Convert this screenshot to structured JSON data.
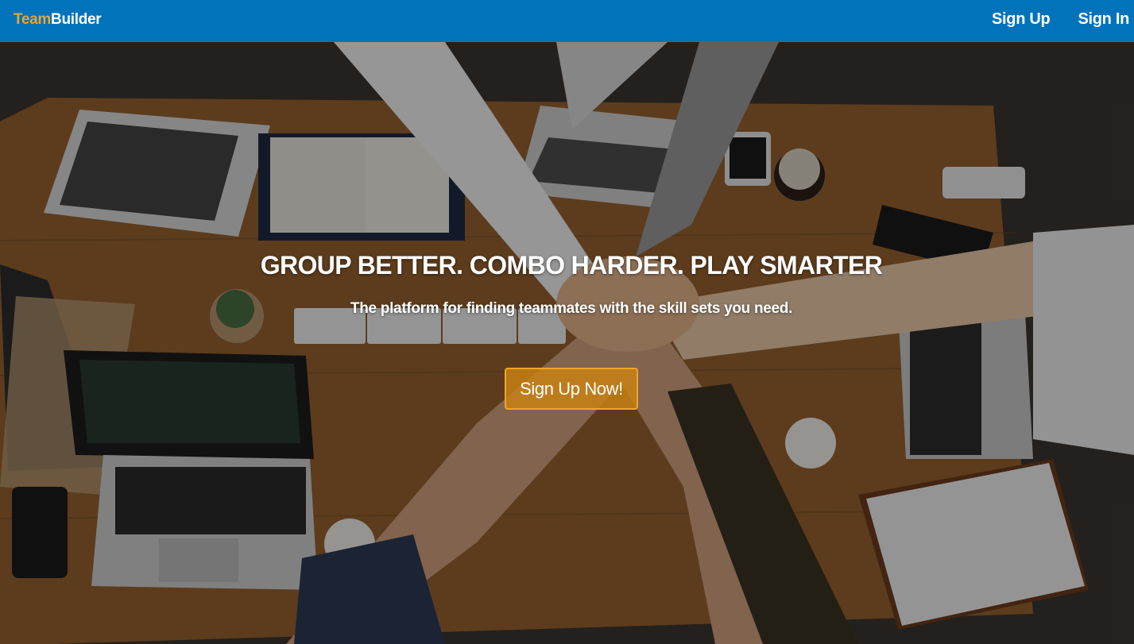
{
  "navbar": {
    "brand_part1": "Team",
    "brand_part2": "Builder",
    "links": [
      "Sign Up",
      "Sign In"
    ],
    "background_color": "#0073bb",
    "brand_accent_color": "#e7a53a"
  },
  "hero": {
    "title": "GROUP BETTER. COMBO HARDER. PLAY SMARTER",
    "subtitle": "The platform for finding teammates with the skill sets you need.",
    "cta_label": "Sign Up Now!",
    "cta_color": "#f0a524",
    "background_image": "team hands stacked over desk with laptops"
  }
}
